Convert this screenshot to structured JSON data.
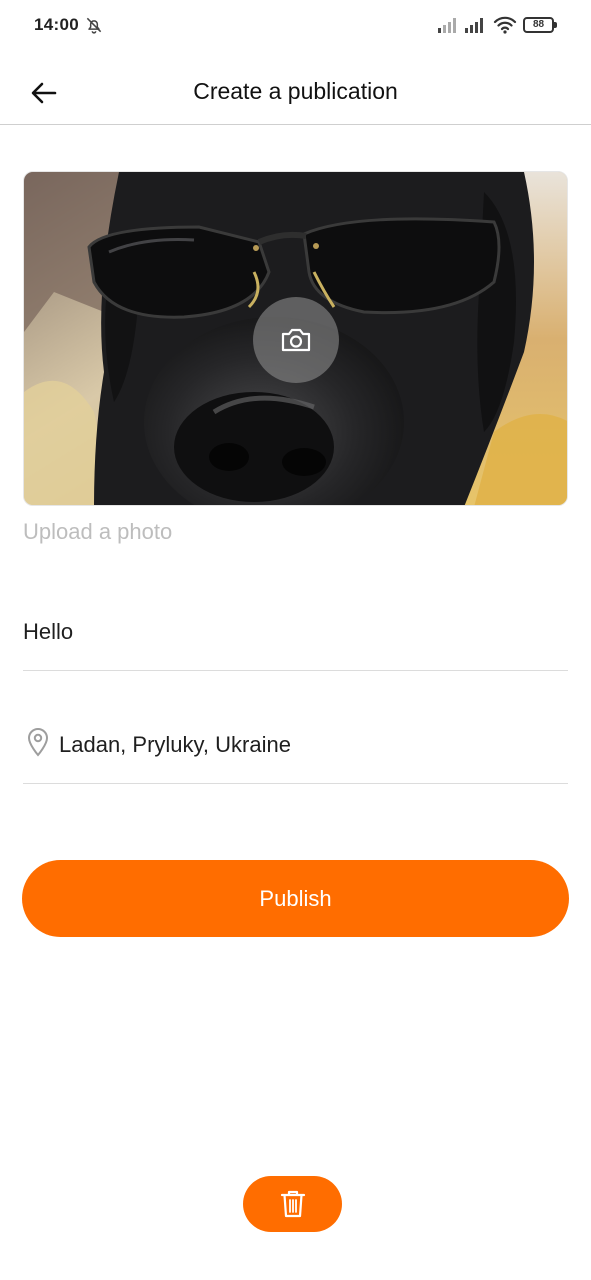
{
  "status_bar": {
    "time": "14:00",
    "battery_level": "88",
    "icons": [
      "bell-off-icon",
      "signal-icon",
      "signal-icon",
      "wifi-icon",
      "battery-icon"
    ]
  },
  "header": {
    "title": "Create a publication",
    "back_icon": "arrow-left-icon"
  },
  "photo": {
    "camera_icon": "camera-icon",
    "upload_label": "Upload a photo"
  },
  "form": {
    "caption_value": "Hello",
    "location_icon": "map-pin-icon",
    "location_value": "Ladan, Pryluky, Ukraine"
  },
  "actions": {
    "publish_label": "Publish",
    "delete_icon": "trash-icon"
  },
  "colors": {
    "accent": "#ff6d00",
    "text": "#1f1f1f",
    "placeholder": "#bdbdbd",
    "divider": "#dcdcdc"
  }
}
